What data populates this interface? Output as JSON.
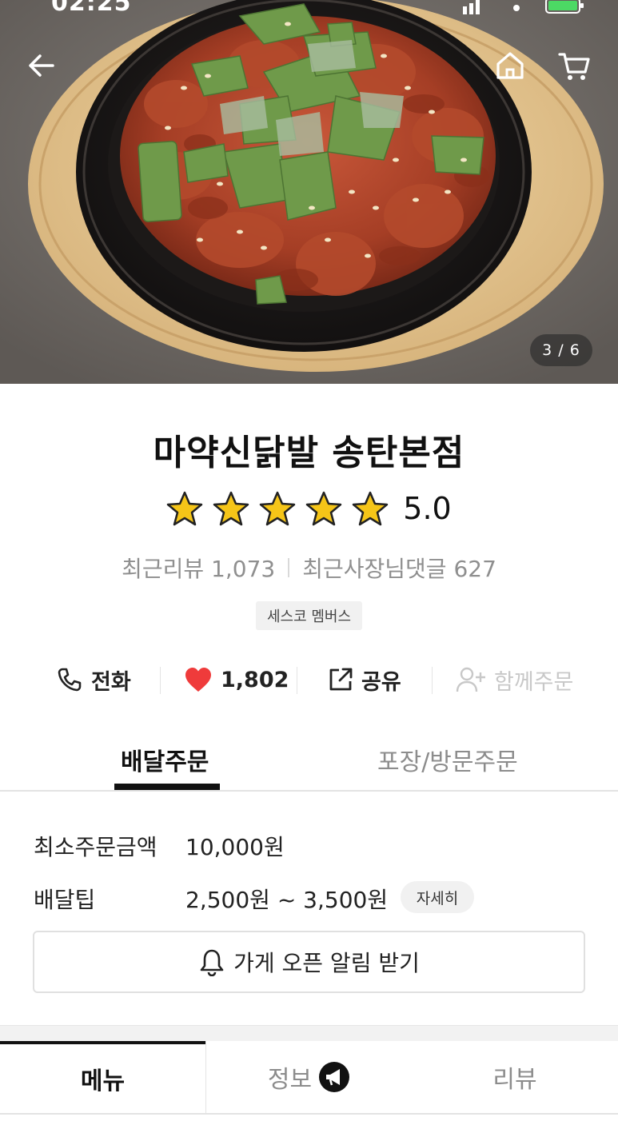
{
  "status_bar": {
    "time": "02:25"
  },
  "hero": {
    "photo_counter": "3 / 6"
  },
  "store": {
    "name": "마약신닭발 송탄본점",
    "rating": "5.0",
    "stars": 5,
    "recent_reviews": "최근리뷰 1,073",
    "recent_owner_replies": "최근사장님댓글 627",
    "badge": "세스코 멤버스"
  },
  "actions": {
    "call_label": "전화",
    "like_count": "1,802",
    "share_label": "공유",
    "group_order_label": "함께주문"
  },
  "order_tabs": {
    "delivery": "배달주문",
    "pickup": "포장/방문주문"
  },
  "delivery_info": {
    "min_order_label": "최소주문금액",
    "min_order_value": "10,000원",
    "tip_label": "배달팁",
    "tip_value": "2,500원 ~ 3,500원",
    "detail_label": "자세히",
    "notify_label": "가게 오픈 알림 받기"
  },
  "bottom_tabs": {
    "menu": "메뉴",
    "info": "정보",
    "review": "리뷰"
  },
  "colors": {
    "heart": "#ef3b3b",
    "star": "#f5c518",
    "text_primary": "#111111",
    "text_muted": "#8c8c8c"
  }
}
